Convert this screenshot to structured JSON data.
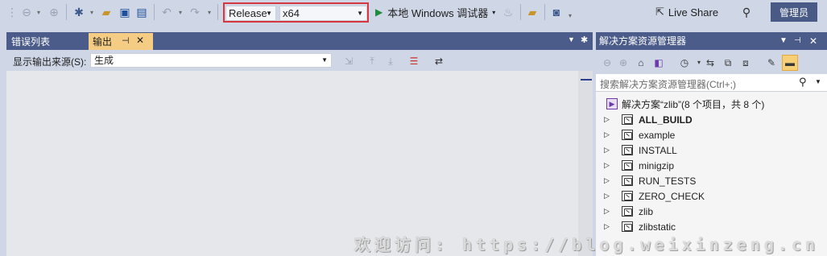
{
  "toolbar": {
    "configuration": "Release",
    "platform": "x64",
    "run_label": "本地 Windows 调试器",
    "live_share_label": "Live Share",
    "admin_label": "管理员"
  },
  "output_panel": {
    "tabs": [
      {
        "label": "错误列表",
        "active": false
      },
      {
        "label": "输出",
        "active": true
      }
    ],
    "pin_glyph": "⊣",
    "close_glyph": "✕",
    "source_label": "显示输出来源(S):",
    "source_value": "生成"
  },
  "solution_explorer": {
    "title": "解决方案资源管理器",
    "search_placeholder": "搜索解决方案资源管理器(Ctrl+;)",
    "root_label": "解决方案“zlib”(8 个项目，共 8 个)",
    "projects": [
      {
        "name": "ALL_BUILD",
        "bold": true
      },
      {
        "name": "example",
        "bold": false
      },
      {
        "name": "INSTALL",
        "bold": false
      },
      {
        "name": "minigzip",
        "bold": false
      },
      {
        "name": "RUN_TESTS",
        "bold": false
      },
      {
        "name": "ZERO_CHECK",
        "bold": false
      },
      {
        "name": "zlib",
        "bold": false
      },
      {
        "name": "zlibstatic",
        "bold": false
      }
    ]
  },
  "watermark": "欢迎访问: https://blog.weixinzeng.cn",
  "colors": {
    "chrome": "#cfd6e5",
    "tab_strip": "#4b5c8a",
    "active_tab": "#f5cc84",
    "highlight_box": "#d6363d",
    "admin_button": "#4a5a86",
    "run_green": "#1f8a3b"
  },
  "icons": [
    "back-icon",
    "forward-icon",
    "new-project-icon",
    "open-folder-icon",
    "save-icon",
    "save-all-icon",
    "undo-icon",
    "redo-icon",
    "play-icon",
    "fire-icon",
    "folder-icon",
    "screenshot-icon",
    "live-share-icon",
    "pin-icon",
    "gear-icon",
    "home-icon",
    "vs-switch-icon",
    "history-icon",
    "sync-icon",
    "copy-icon",
    "wrench-icon",
    "search-icon"
  ]
}
